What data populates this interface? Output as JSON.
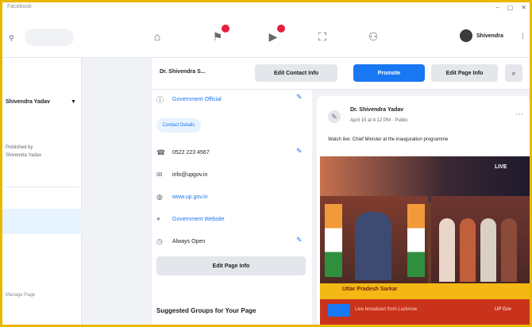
{
  "window": {
    "title": "Facebook",
    "controls": [
      "–",
      "▢",
      "✕"
    ]
  },
  "topnav": {
    "search_icon": "search-icon",
    "icons": [
      "home-icon",
      "flag-icon",
      "video-icon",
      "marketplace-icon",
      "groups-icon"
    ],
    "profile_name": "Shivendra",
    "menu_icon": "grid-menu-icon"
  },
  "left_panel": {
    "title": "Shivendra Yadav",
    "text_lines": [
      "Published by",
      "Shivendra Yadav"
    ],
    "footer": "Manage Page"
  },
  "actionbar": {
    "page_name": "Dr. Shivendra S...",
    "buttons": [
      "Edit Contact Info",
      "Promote",
      "Edit Page Info"
    ],
    "more_icon": "more-icon"
  },
  "about": {
    "rows": [
      {
        "icon": "info-icon",
        "text": "Government Official",
        "link": true,
        "editable": true
      },
      {
        "icon": "phone-icon",
        "text": "0522 223 4567",
        "link": false,
        "editable": true
      },
      {
        "icon": "mail-icon",
        "text": "info@upgov.in",
        "link": false,
        "editable": false
      },
      {
        "icon": "globe-icon",
        "text": "www.up.gov.in",
        "link": true,
        "editable": false
      },
      {
        "icon": "pin-icon",
        "text": "Government Website",
        "link": true,
        "editable": false
      },
      {
        "icon": "clock-icon",
        "text": "Always Open",
        "link": false,
        "editable": true
      }
    ],
    "tag": "Contact Details",
    "edit_page_button": "Edit Page Info",
    "suggested_heading": "Suggested Groups for Your Page"
  },
  "post": {
    "author": "Dr. Shivendra Yadav",
    "meta": "April 15 at 4:12 PM · Public",
    "text": "Watch live: Chief Minister at the inauguration programme",
    "image": {
      "badge": "LIVE",
      "band_text": "Uttar Pradesh Sarkar",
      "bottom_text": "Live broadcast from Lucknow",
      "bottom_right": "UP Gov"
    }
  },
  "colors": {
    "frame": "#e8b800",
    "accent": "#1877f2",
    "notify": "#e41e3f"
  }
}
